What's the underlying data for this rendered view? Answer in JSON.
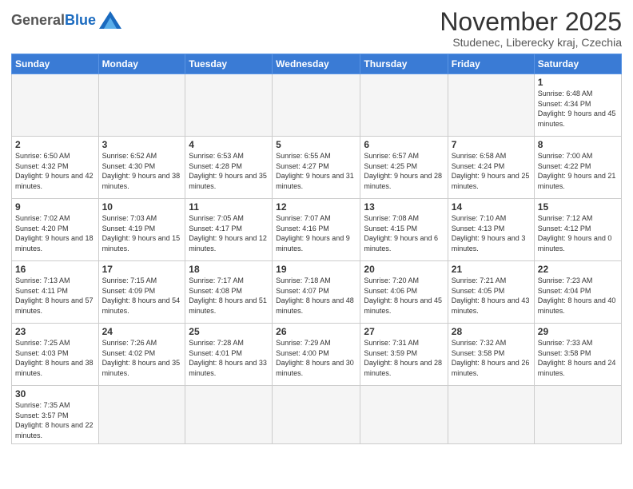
{
  "header": {
    "logo_general": "General",
    "logo_blue": "Blue",
    "month_title": "November 2025",
    "subtitle": "Studenec, Liberecky kraj, Czechia"
  },
  "weekdays": [
    "Sunday",
    "Monday",
    "Tuesday",
    "Wednesday",
    "Thursday",
    "Friday",
    "Saturday"
  ],
  "weeks": [
    [
      {
        "day": null,
        "info": ""
      },
      {
        "day": null,
        "info": ""
      },
      {
        "day": null,
        "info": ""
      },
      {
        "day": null,
        "info": ""
      },
      {
        "day": null,
        "info": ""
      },
      {
        "day": null,
        "info": ""
      },
      {
        "day": "1",
        "info": "Sunrise: 6:48 AM\nSunset: 4:34 PM\nDaylight: 9 hours and 45 minutes."
      }
    ],
    [
      {
        "day": "2",
        "info": "Sunrise: 6:50 AM\nSunset: 4:32 PM\nDaylight: 9 hours and 42 minutes."
      },
      {
        "day": "3",
        "info": "Sunrise: 6:52 AM\nSunset: 4:30 PM\nDaylight: 9 hours and 38 minutes."
      },
      {
        "day": "4",
        "info": "Sunrise: 6:53 AM\nSunset: 4:28 PM\nDaylight: 9 hours and 35 minutes."
      },
      {
        "day": "5",
        "info": "Sunrise: 6:55 AM\nSunset: 4:27 PM\nDaylight: 9 hours and 31 minutes."
      },
      {
        "day": "6",
        "info": "Sunrise: 6:57 AM\nSunset: 4:25 PM\nDaylight: 9 hours and 28 minutes."
      },
      {
        "day": "7",
        "info": "Sunrise: 6:58 AM\nSunset: 4:24 PM\nDaylight: 9 hours and 25 minutes."
      },
      {
        "day": "8",
        "info": "Sunrise: 7:00 AM\nSunset: 4:22 PM\nDaylight: 9 hours and 21 minutes."
      }
    ],
    [
      {
        "day": "9",
        "info": "Sunrise: 7:02 AM\nSunset: 4:20 PM\nDaylight: 9 hours and 18 minutes."
      },
      {
        "day": "10",
        "info": "Sunrise: 7:03 AM\nSunset: 4:19 PM\nDaylight: 9 hours and 15 minutes."
      },
      {
        "day": "11",
        "info": "Sunrise: 7:05 AM\nSunset: 4:17 PM\nDaylight: 9 hours and 12 minutes."
      },
      {
        "day": "12",
        "info": "Sunrise: 7:07 AM\nSunset: 4:16 PM\nDaylight: 9 hours and 9 minutes."
      },
      {
        "day": "13",
        "info": "Sunrise: 7:08 AM\nSunset: 4:15 PM\nDaylight: 9 hours and 6 minutes."
      },
      {
        "day": "14",
        "info": "Sunrise: 7:10 AM\nSunset: 4:13 PM\nDaylight: 9 hours and 3 minutes."
      },
      {
        "day": "15",
        "info": "Sunrise: 7:12 AM\nSunset: 4:12 PM\nDaylight: 9 hours and 0 minutes."
      }
    ],
    [
      {
        "day": "16",
        "info": "Sunrise: 7:13 AM\nSunset: 4:11 PM\nDaylight: 8 hours and 57 minutes."
      },
      {
        "day": "17",
        "info": "Sunrise: 7:15 AM\nSunset: 4:09 PM\nDaylight: 8 hours and 54 minutes."
      },
      {
        "day": "18",
        "info": "Sunrise: 7:17 AM\nSunset: 4:08 PM\nDaylight: 8 hours and 51 minutes."
      },
      {
        "day": "19",
        "info": "Sunrise: 7:18 AM\nSunset: 4:07 PM\nDaylight: 8 hours and 48 minutes."
      },
      {
        "day": "20",
        "info": "Sunrise: 7:20 AM\nSunset: 4:06 PM\nDaylight: 8 hours and 45 minutes."
      },
      {
        "day": "21",
        "info": "Sunrise: 7:21 AM\nSunset: 4:05 PM\nDaylight: 8 hours and 43 minutes."
      },
      {
        "day": "22",
        "info": "Sunrise: 7:23 AM\nSunset: 4:04 PM\nDaylight: 8 hours and 40 minutes."
      }
    ],
    [
      {
        "day": "23",
        "info": "Sunrise: 7:25 AM\nSunset: 4:03 PM\nDaylight: 8 hours and 38 minutes."
      },
      {
        "day": "24",
        "info": "Sunrise: 7:26 AM\nSunset: 4:02 PM\nDaylight: 8 hours and 35 minutes."
      },
      {
        "day": "25",
        "info": "Sunrise: 7:28 AM\nSunset: 4:01 PM\nDaylight: 8 hours and 33 minutes."
      },
      {
        "day": "26",
        "info": "Sunrise: 7:29 AM\nSunset: 4:00 PM\nDaylight: 8 hours and 30 minutes."
      },
      {
        "day": "27",
        "info": "Sunrise: 7:31 AM\nSunset: 3:59 PM\nDaylight: 8 hours and 28 minutes."
      },
      {
        "day": "28",
        "info": "Sunrise: 7:32 AM\nSunset: 3:58 PM\nDaylight: 8 hours and 26 minutes."
      },
      {
        "day": "29",
        "info": "Sunrise: 7:33 AM\nSunset: 3:58 PM\nDaylight: 8 hours and 24 minutes."
      }
    ],
    [
      {
        "day": "30",
        "info": "Sunrise: 7:35 AM\nSunset: 3:57 PM\nDaylight: 8 hours and 22 minutes."
      },
      {
        "day": null,
        "info": ""
      },
      {
        "day": null,
        "info": ""
      },
      {
        "day": null,
        "info": ""
      },
      {
        "day": null,
        "info": ""
      },
      {
        "day": null,
        "info": ""
      },
      {
        "day": null,
        "info": ""
      }
    ]
  ]
}
